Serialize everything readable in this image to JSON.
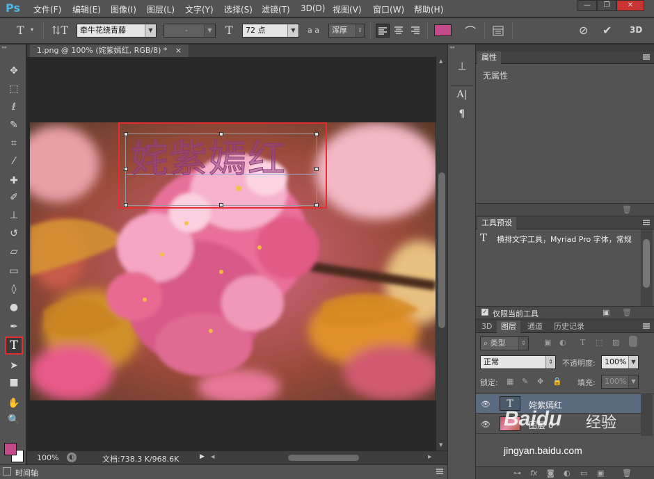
{
  "app": {
    "logo": "Ps"
  },
  "menu": [
    "文件(F)",
    "编辑(E)",
    "图像(I)",
    "图层(L)",
    "文字(Y)",
    "选择(S)",
    "滤镜(T)",
    "3D(D)",
    "视图(V)",
    "窗口(W)",
    "帮助(H)"
  ],
  "window_buttons": {
    "minimize": "—",
    "restore": "❐",
    "close": "✕"
  },
  "options": {
    "font_family": "牵牛花绕青藤",
    "font_style": "-",
    "font_size": "72 点",
    "aa_label": "a a",
    "antialias": "浑厚",
    "text_color": "#c24a8a",
    "threed_label": "3D"
  },
  "document": {
    "tab_title": "1.png @ 100% (姹紫嫣红, RGB/8) *",
    "tab_close": "×",
    "text_layer_content": "姹紫嫣红"
  },
  "status": {
    "zoom": "100%",
    "doc_size": "文档:738.3 K/968.6K"
  },
  "timeline": {
    "label": "时间轴"
  },
  "properties": {
    "tab": "属性",
    "body": "无属性"
  },
  "tool_presets": {
    "tab": "工具预设",
    "item": "横排文字工具，Myriad Pro 字体，常规",
    "only_current_label": "仅限当前工具"
  },
  "layers_panel": {
    "tabs": [
      "3D",
      "图层",
      "通道",
      "历史记录"
    ],
    "filter_kind": "类型",
    "blend_mode": "正常",
    "opacity_label": "不透明度:",
    "opacity_value": "100%",
    "lock_label": "锁定:",
    "fill_label": "填充:",
    "fill_value": "100%",
    "layers": [
      {
        "name": "姹紫嫣红",
        "type": "text",
        "selected": true
      },
      {
        "name": "图层 0",
        "type": "image",
        "selected": false
      }
    ]
  },
  "watermark": {
    "brand": "Baidu",
    "brand_cn": "经验",
    "url": "jingyan.baidu.com"
  },
  "colors": {
    "foreground": "#c24a8a",
    "background": "#ffffff",
    "highlight": "#e03030"
  }
}
